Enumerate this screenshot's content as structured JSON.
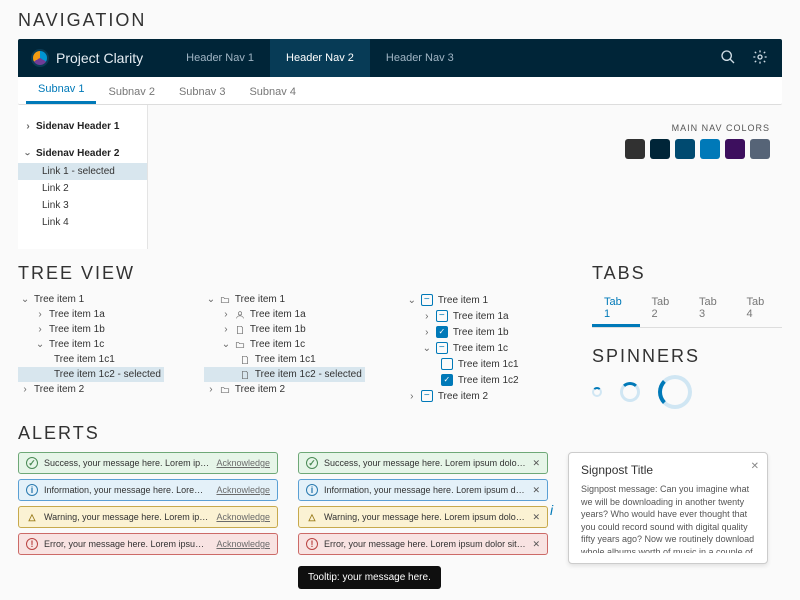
{
  "sections": {
    "navigation": "NAVIGATION",
    "tree": "TREE VIEW",
    "tabs": "TABS",
    "spinners": "SPINNERS",
    "alerts": "ALERTS"
  },
  "header": {
    "brand": "Project Clarity",
    "tabs": [
      "Header Nav 1",
      "Header Nav 2",
      "Header Nav 3"
    ],
    "active": 1
  },
  "subnav": {
    "tabs": [
      "Subnav 1",
      "Subnav 2",
      "Subnav 3",
      "Subnav 4"
    ],
    "active": 0
  },
  "sidenav": {
    "group1": "Sidenav Header 1",
    "group2": "Sidenav Header 2",
    "links": [
      "Link 1 - selected",
      "Link 2",
      "Link 3",
      "Link 4"
    ]
  },
  "navcolors": {
    "label": "MAIN NAV COLORS",
    "swatches": [
      "#313131",
      "#002538",
      "#004a70",
      "#0079b8",
      "#3d0f5e",
      "#566477"
    ]
  },
  "tree": {
    "items": {
      "i1": "Tree item 1",
      "i1a": "Tree item 1a",
      "i1b": "Tree item 1b",
      "i1c": "Tree item 1c",
      "i1c1": "Tree item 1c1",
      "i1c2": "Tree item 1c2",
      "i1c2_sel": "Tree item 1c2 - selected",
      "i2": "Tree item 2"
    }
  },
  "tabs": {
    "items": [
      "Tab 1",
      "Tab 2",
      "Tab 3",
      "Tab 4"
    ],
    "active": 0
  },
  "alerts": {
    "ack": "Acknowledge",
    "success": "Success, your message here. Lorem ipsum dolor sit amet",
    "info": "Information, your message here. Lorem ipsum dolor sit",
    "warn": "Warning, your message here. Lorem ipsum dolor sit amet",
    "error": "Error, your message here. Lorem ipsum dolor sit amet",
    "success2": "Success, your message here. Lorem ipsum dolor sit amet",
    "info2": "Information, your message here. Lorem ipsum dolor sit amet",
    "warn2": "Warning, your message here. Lorem ipsum dolor sit amet",
    "error2": "Error, your message here. Lorem ipsum dolor sit amet"
  },
  "tooltip": "Tooltip: your message here.",
  "signpost": {
    "title": "Signpost Title",
    "body": "Signpost message: Can you imagine what we will be downloading in another twenty years? Who would have ever thought that you could record sound with digital quality fifty years ago? Now we routinely download whole albums worth of music in a couple of"
  }
}
